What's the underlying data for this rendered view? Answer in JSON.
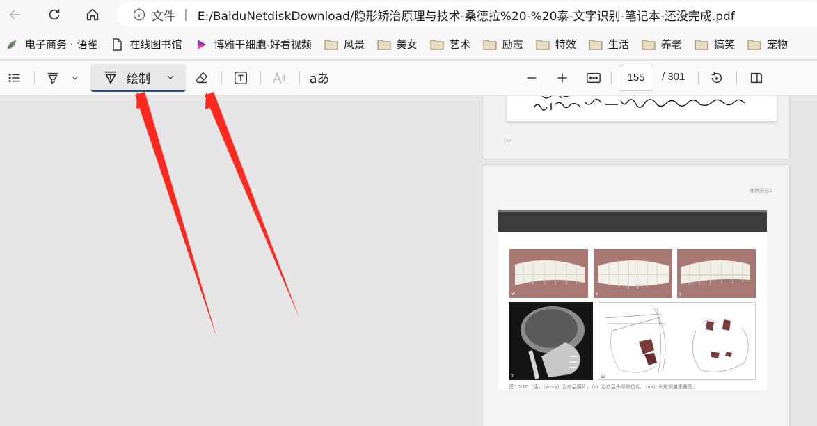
{
  "browser": {
    "address": {
      "scheme_label": "文件",
      "separator": "|",
      "url": "E:/BaiduNetdiskDownload/隐形矫治原理与技术-桑德拉%20-%20泰-文字识别-笔记本-还没完成.pdf"
    }
  },
  "bookmarks": [
    {
      "label": "电子商务 · 语雀",
      "icon": "yuque-leaf-icon"
    },
    {
      "label": "在线图书馆",
      "icon": "document-icon"
    },
    {
      "label": "博雅干细胞-好看视频",
      "icon": "video-play-icon"
    },
    {
      "label": "风景",
      "icon": "folder-icon"
    },
    {
      "label": "美女",
      "icon": "folder-icon"
    },
    {
      "label": "艺术",
      "icon": "folder-icon"
    },
    {
      "label": "励志",
      "icon": "folder-icon"
    },
    {
      "label": "特效",
      "icon": "folder-icon"
    },
    {
      "label": "生活",
      "icon": "folder-icon"
    },
    {
      "label": "养老",
      "icon": "folder-icon"
    },
    {
      "label": "搞笑",
      "icon": "folder-icon"
    },
    {
      "label": "宠物",
      "icon": "folder-icon"
    }
  ],
  "pdf_toolbar": {
    "draw_label": "绘制",
    "aa_label": "aあ",
    "page_current": "155",
    "page_total": "/ 301"
  },
  "document": {
    "prev_page_number": "150",
    "page_header": "病例报告2",
    "photo_labels": [
      "w",
      "x",
      "y",
      "z",
      "aa"
    ],
    "caption": "图10-10（续）（w～y）治疗后照片。（z）治疗后头颅侧位片。（aa）头影测量重叠图。",
    "handwriting": "① 以后的要看,后方调整后的牙齿咬合能力较差"
  },
  "colors": {
    "arrow": "#ff2a1f",
    "draw_underline": "#1f4e8c",
    "page_bg": "#e6e6e6"
  }
}
